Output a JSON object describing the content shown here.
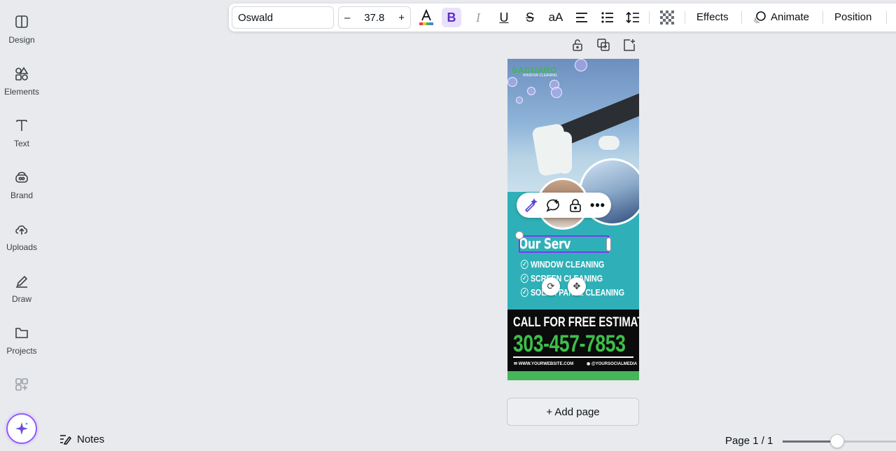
{
  "sidebar": {
    "items": [
      {
        "label": "Design",
        "icon": "design-icon"
      },
      {
        "label": "Elements",
        "icon": "elements-icon"
      },
      {
        "label": "Text",
        "icon": "text-icon"
      },
      {
        "label": "Brand",
        "icon": "brand-icon"
      },
      {
        "label": "Uploads",
        "icon": "uploads-icon"
      },
      {
        "label": "Draw",
        "icon": "draw-icon"
      },
      {
        "label": "Projects",
        "icon": "projects-icon"
      },
      {
        "label": "",
        "icon": "apps-icon"
      }
    ],
    "magic_icon": "magic-sparkle-icon"
  },
  "toolbar": {
    "font": "Oswald",
    "font_size": "37.8",
    "minus": "–",
    "plus": "+",
    "effects": "Effects",
    "animate": "Animate",
    "position": "Position",
    "accent": "#7c3aed"
  },
  "flyer": {
    "logo": "SAGUARO",
    "logo_sub": "WINDOW CLEANING",
    "heading": "Our Serv",
    "services": [
      "WINDOW CLEANING",
      "SCREEN CLEANING",
      "SOLAR PANEL CLEANING"
    ],
    "cta": "CALL FOR FREE ESTIMATE",
    "phone": "303-457-7853",
    "website": "WWW.YOURWEBSITE.COM",
    "social": "@YOURSOCIALMEDIA",
    "colors": {
      "teal": "#2fb0b8",
      "green": "#3dbf4a",
      "black": "#0b0b0b"
    }
  },
  "add_page": "+ Add page",
  "notes": "Notes",
  "page_indicator": "Page 1 / 1",
  "zoom_level": 0.42
}
